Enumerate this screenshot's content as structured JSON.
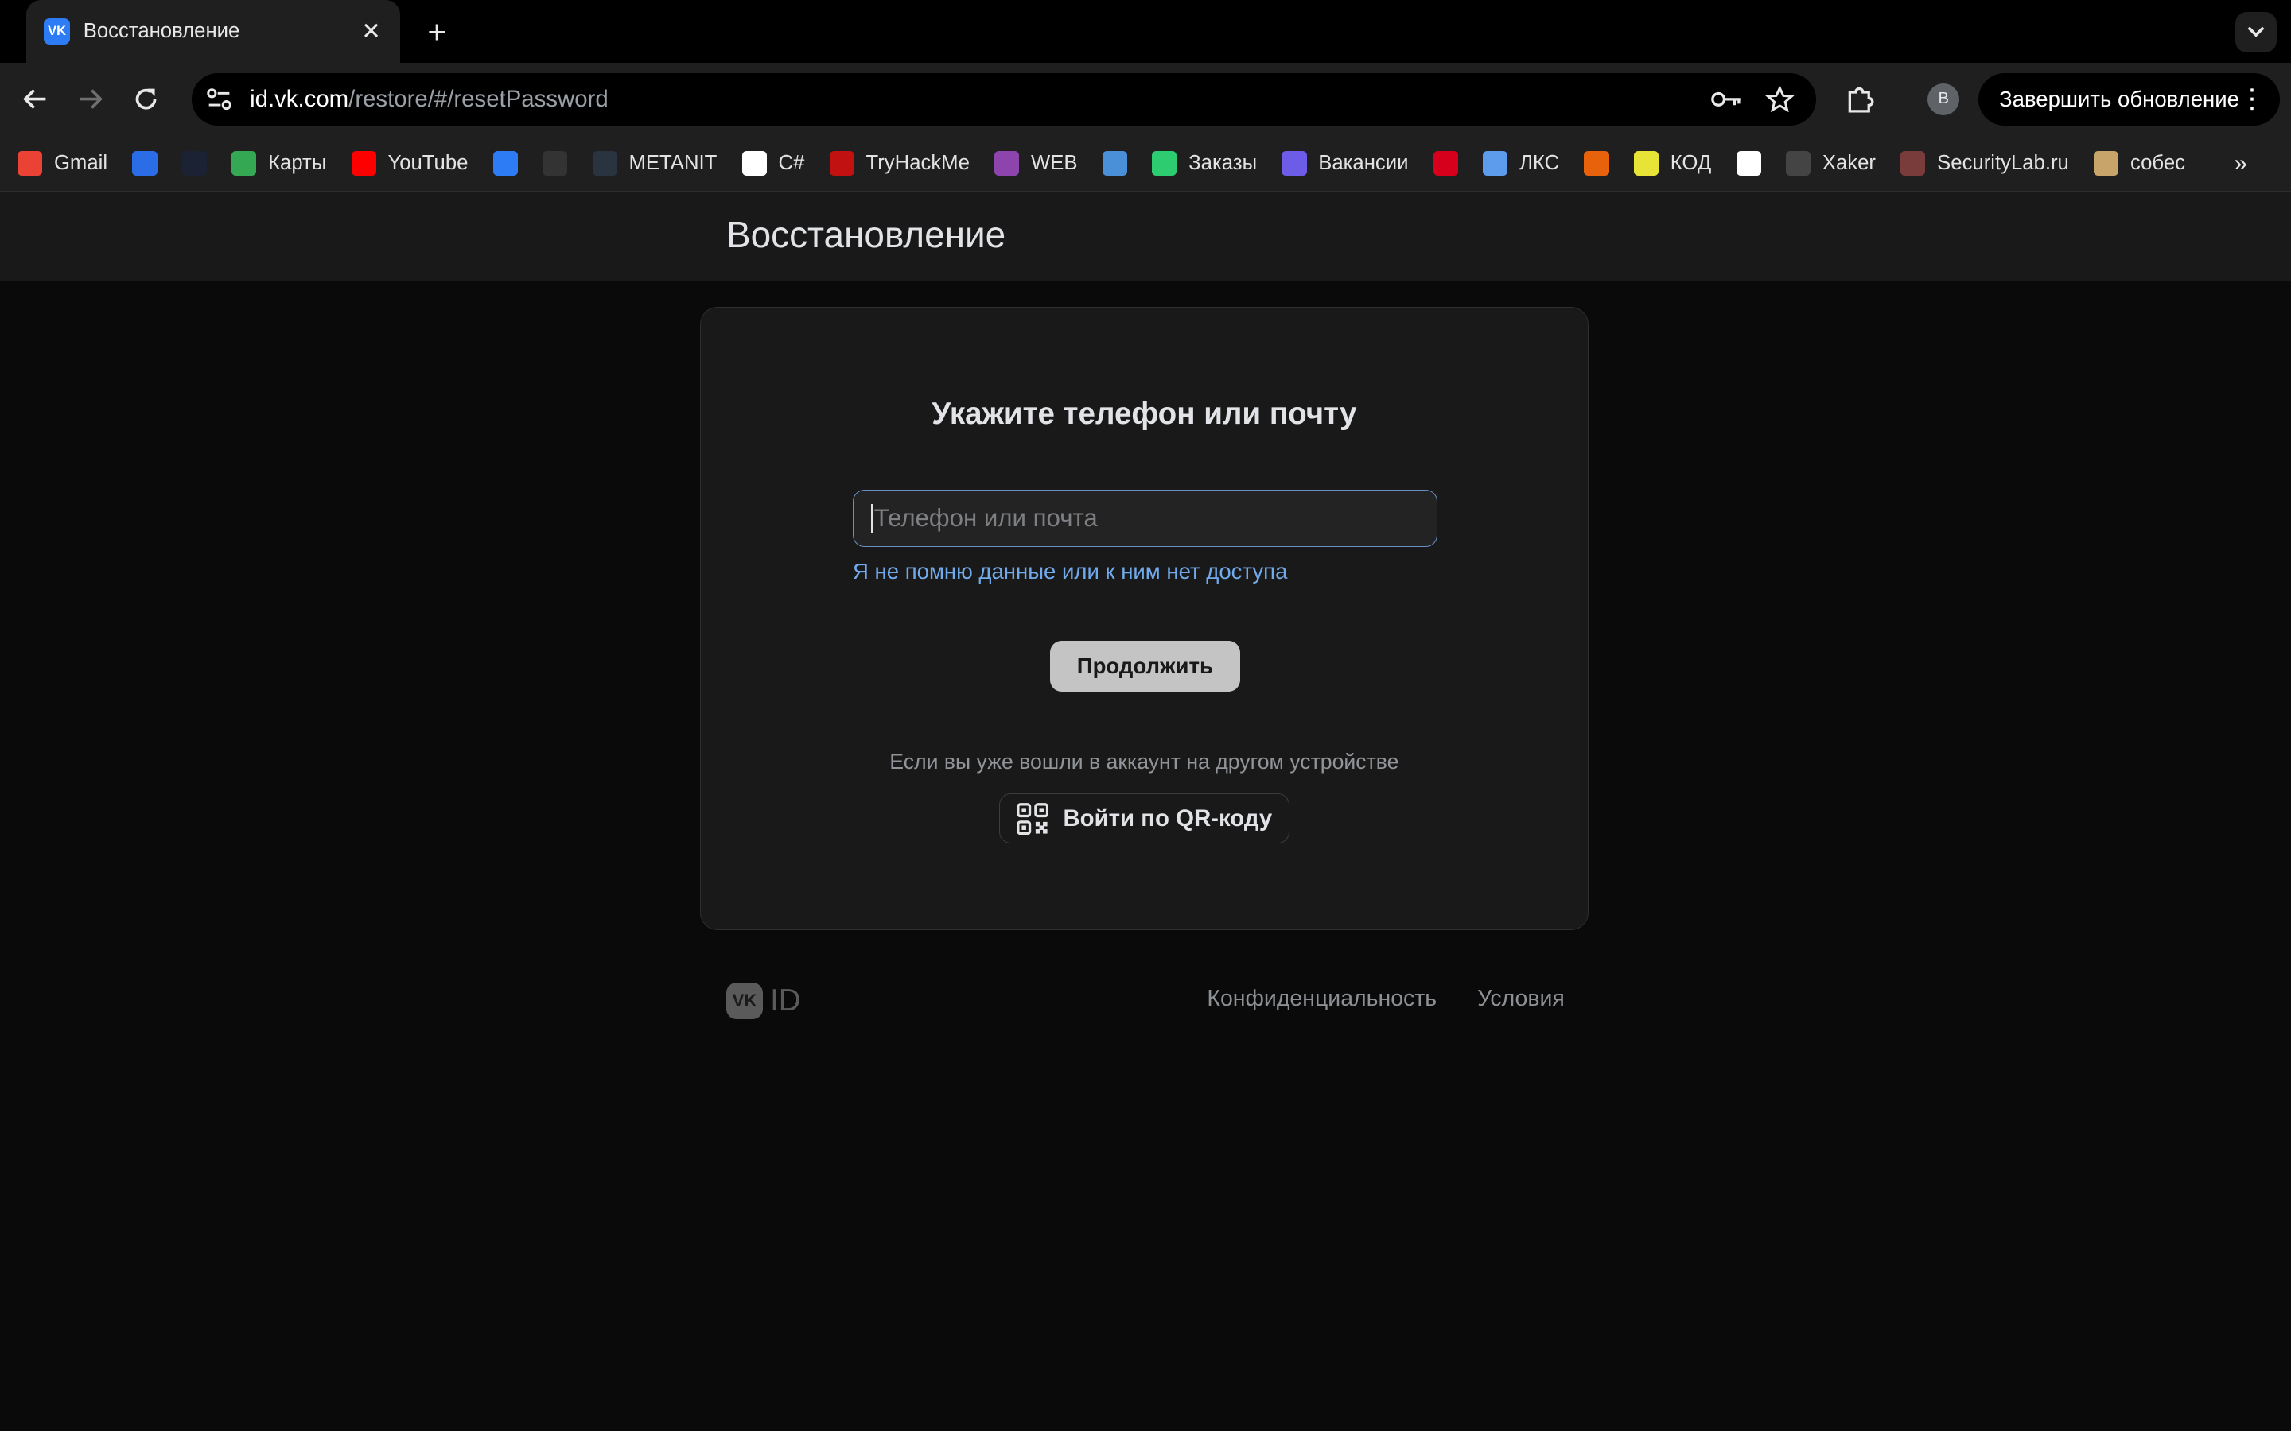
{
  "browser": {
    "tab": {
      "title": "Восстановление",
      "favicon_text": "VK"
    },
    "address": {
      "host": "id.vk.com",
      "path": "/restore/#/resetPassword"
    },
    "avatar_letter": "B",
    "update_label": "Завершить обновление",
    "bookmarks": [
      {
        "label": "Gmail",
        "icon": "gmail-icon",
        "color": "#ea4335"
      },
      {
        "label": "",
        "icon": "mail-icon",
        "color": "#2b6de6"
      },
      {
        "label": "",
        "icon": "play-icon",
        "color": "#1a2233"
      },
      {
        "label": "Карты",
        "icon": "maps-pin-icon",
        "color": "#34a853"
      },
      {
        "label": "YouTube",
        "icon": "youtube-icon",
        "color": "#ff0000"
      },
      {
        "label": "",
        "icon": "vk-icon",
        "color": "#2d7cf6"
      },
      {
        "label": "",
        "icon": "swirl-icon",
        "color": "#333333"
      },
      {
        "label": "METANIT",
        "icon": "metanit-icon",
        "color": "#2a3340"
      },
      {
        "label": "C#",
        "icon": "ulearn-icon",
        "color": "#ffffff"
      },
      {
        "label": "TryHackMe",
        "icon": "cloud-icon",
        "color": "#c11111"
      },
      {
        "label": "WEB",
        "icon": "html-icon",
        "color": "#8e44ad"
      },
      {
        "label": "",
        "icon": "gear-icon",
        "color": "#4a90d9"
      },
      {
        "label": "Заказы",
        "icon": "gear-icon",
        "color": "#2ecc71"
      },
      {
        "label": "Вакансии",
        "icon": "gear-icon",
        "color": "#6c5ce7"
      },
      {
        "label": "",
        "icon": "hh-icon",
        "color": "#d6001c"
      },
      {
        "label": "ЛКС",
        "icon": "monitor-icon",
        "color": "#5d9cec"
      },
      {
        "label": "",
        "icon": "kontur-icon",
        "color": "#e8620b"
      },
      {
        "label": "КОД",
        "icon": "kod-icon",
        "color": "#e8e337"
      },
      {
        "label": "",
        "icon": "github-icon",
        "color": "#ffffff"
      },
      {
        "label": "Xaker",
        "icon": "xaker-icon",
        "color": "#444444"
      },
      {
        "label": "SecurityLab.ru",
        "icon": "securitylab-icon",
        "color": "#7a3b3b"
      },
      {
        "label": "собес",
        "icon": "image-icon",
        "color": "#c8a46a"
      }
    ]
  },
  "page": {
    "header_title": "Восстановление",
    "card": {
      "title": "Укажите телефон или почту",
      "input_placeholder": "Телефон или почта",
      "no_access_link": "Я не помню данные или к ним нет доступа",
      "continue_label": "Продолжить",
      "hint": "Если вы уже вошли в аккаунт на другом устройстве",
      "qr_label": "Войти по QR-коду"
    },
    "footer": {
      "logo_mark": "VK",
      "logo_text": "ID",
      "privacy": "Конфиденциальность",
      "terms": "Условия"
    }
  }
}
